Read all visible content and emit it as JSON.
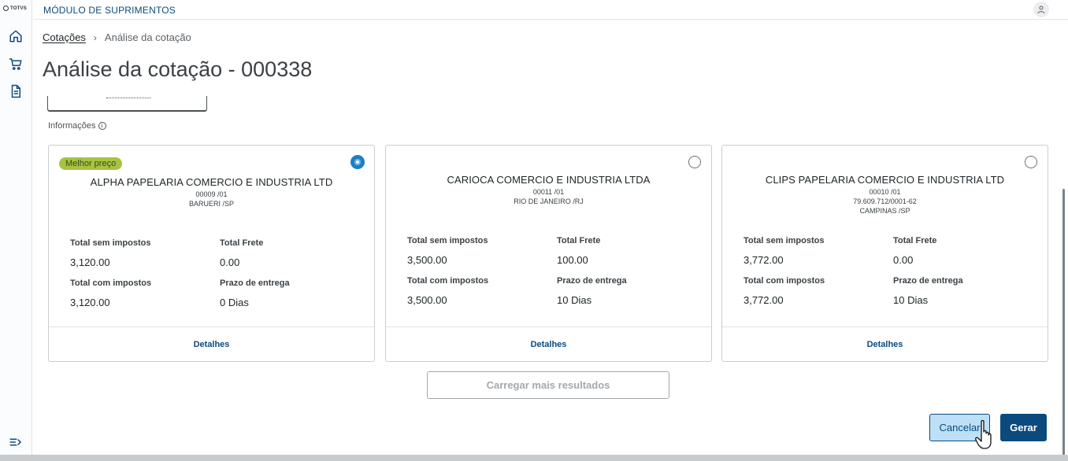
{
  "app": {
    "logo_text": "TOTVS",
    "module_title": "MÓDULO DE SUPRIMENTOS"
  },
  "icons": {
    "home": "home-icon",
    "cart": "cart-icon",
    "document": "document-icon",
    "menu_expand": "menu-expand-icon",
    "user": "user-icon",
    "info": "info-icon"
  },
  "breadcrumb": {
    "link": "Cotações",
    "separator": "›",
    "current": "Análise da cotação"
  },
  "page": {
    "title": "Análise da cotação - 000338"
  },
  "info_label": "Informações",
  "labels": {
    "total_sem_impostos": "Total sem impostos",
    "total_frete": "Total Frete",
    "total_com_impostos": "Total com impostos",
    "prazo_entrega": "Prazo de entrega",
    "details": "Detalhes"
  },
  "cards": [
    {
      "badge": "Melhor preço",
      "selected": true,
      "name": "ALPHA PAPELARIA COMERCIO E INDUSTRIA LTD",
      "lines": [
        "00009 /01",
        "BARUERI /SP"
      ],
      "total_sem_impostos": "3,120.00",
      "total_frete": "0.00",
      "total_com_impostos": "3,120.00",
      "prazo_entrega": "0 Dias"
    },
    {
      "badge": "",
      "selected": false,
      "name": "CARIOCA COMERCIO E INDUSTRIA LTDA",
      "lines": [
        "00011 /01",
        "RIO DE JANEIRO /RJ"
      ],
      "total_sem_impostos": "3,500.00",
      "total_frete": "100.00",
      "total_com_impostos": "3,500.00",
      "prazo_entrega": "10 Dias"
    },
    {
      "badge": "",
      "selected": false,
      "name": "CLIPS PAPELARIA COMERCIO E INDUSTRIA LTD",
      "lines": [
        "00010 /01",
        "79.609.712/0001-62",
        "CAMPINAS /SP"
      ],
      "total_sem_impostos": "3,772.00",
      "total_frete": "0.00",
      "total_com_impostos": "3,772.00",
      "prazo_entrega": "10 Dias"
    }
  ],
  "actions": {
    "load_more": "Carregar mais resultados",
    "cancel": "Cancelar",
    "generate": "Gerar"
  },
  "colors": {
    "primary": "#0c4a7e",
    "badge": "#a6c344",
    "radio_selected": "#1d7fc4",
    "cancel_bg": "#bde0f6"
  }
}
